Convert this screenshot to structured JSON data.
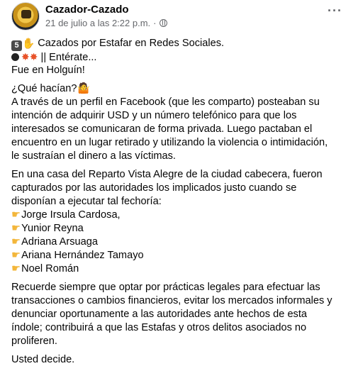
{
  "header": {
    "author": "Cazador-Cazado",
    "timestamp": "21 de julio a las 2:22 p.m.",
    "separator": "·",
    "more_label": "···"
  },
  "post": {
    "badge": "5",
    "line1": " Cazados por Estafar en Redes Sociales.",
    "line2": " || Entérate...",
    "line3": "Fue en Holguín!",
    "q": "¿Qué hacían?",
    "p1": [
      "A través de un perfil en Facebook (que les comparto) posteaban su",
      "intención de adquirir USD y un número telefónico para que los",
      "interesados se comunicaran de forma privada. Luego pactaban el",
      "encuentro en un lugar retirado y utilizando la violencia o intimidación,",
      "le sustraían el dinero a las víctimas."
    ],
    "p2": [
      "En una casa del Reparto Vista Alegre de la ciudad cabecera, fueron",
      "capturados por las autoridades los implicados justo cuando se",
      "disponían a ejecutar tal fechoría:"
    ],
    "names": [
      "Jorge Irsula Cardosa,",
      "Yunior Reyna",
      "Adriana Arsuaga",
      "Ariana Hernández Tamayo",
      "Noel Román"
    ],
    "p3": [
      "Recuerde siempre que optar por prácticas legales para efectuar las",
      "transacciones o cambios financieros, evitar los mercados informales y",
      "denunciar oportunamente a las autoridades ante hechos de esta",
      "índole; contribuirá a que las Estafas y otros delitos asociados no",
      "proliferen."
    ],
    "closing": " Usted decide."
  },
  "icons": {
    "badge": "keycap-5-icon",
    "wave": "raised-hand-icon",
    "bomb": "bomb-icon",
    "boom": "collision-icon",
    "person": "person-shrugging-icon",
    "pointer": "backhand-index-pointing-right-icon",
    "privacy": "globe-icon"
  },
  "colors": {
    "text": "#050505",
    "meta": "#65676b",
    "emoji_hand": "#f3b63a",
    "emoji_boom": "#e8532a"
  }
}
